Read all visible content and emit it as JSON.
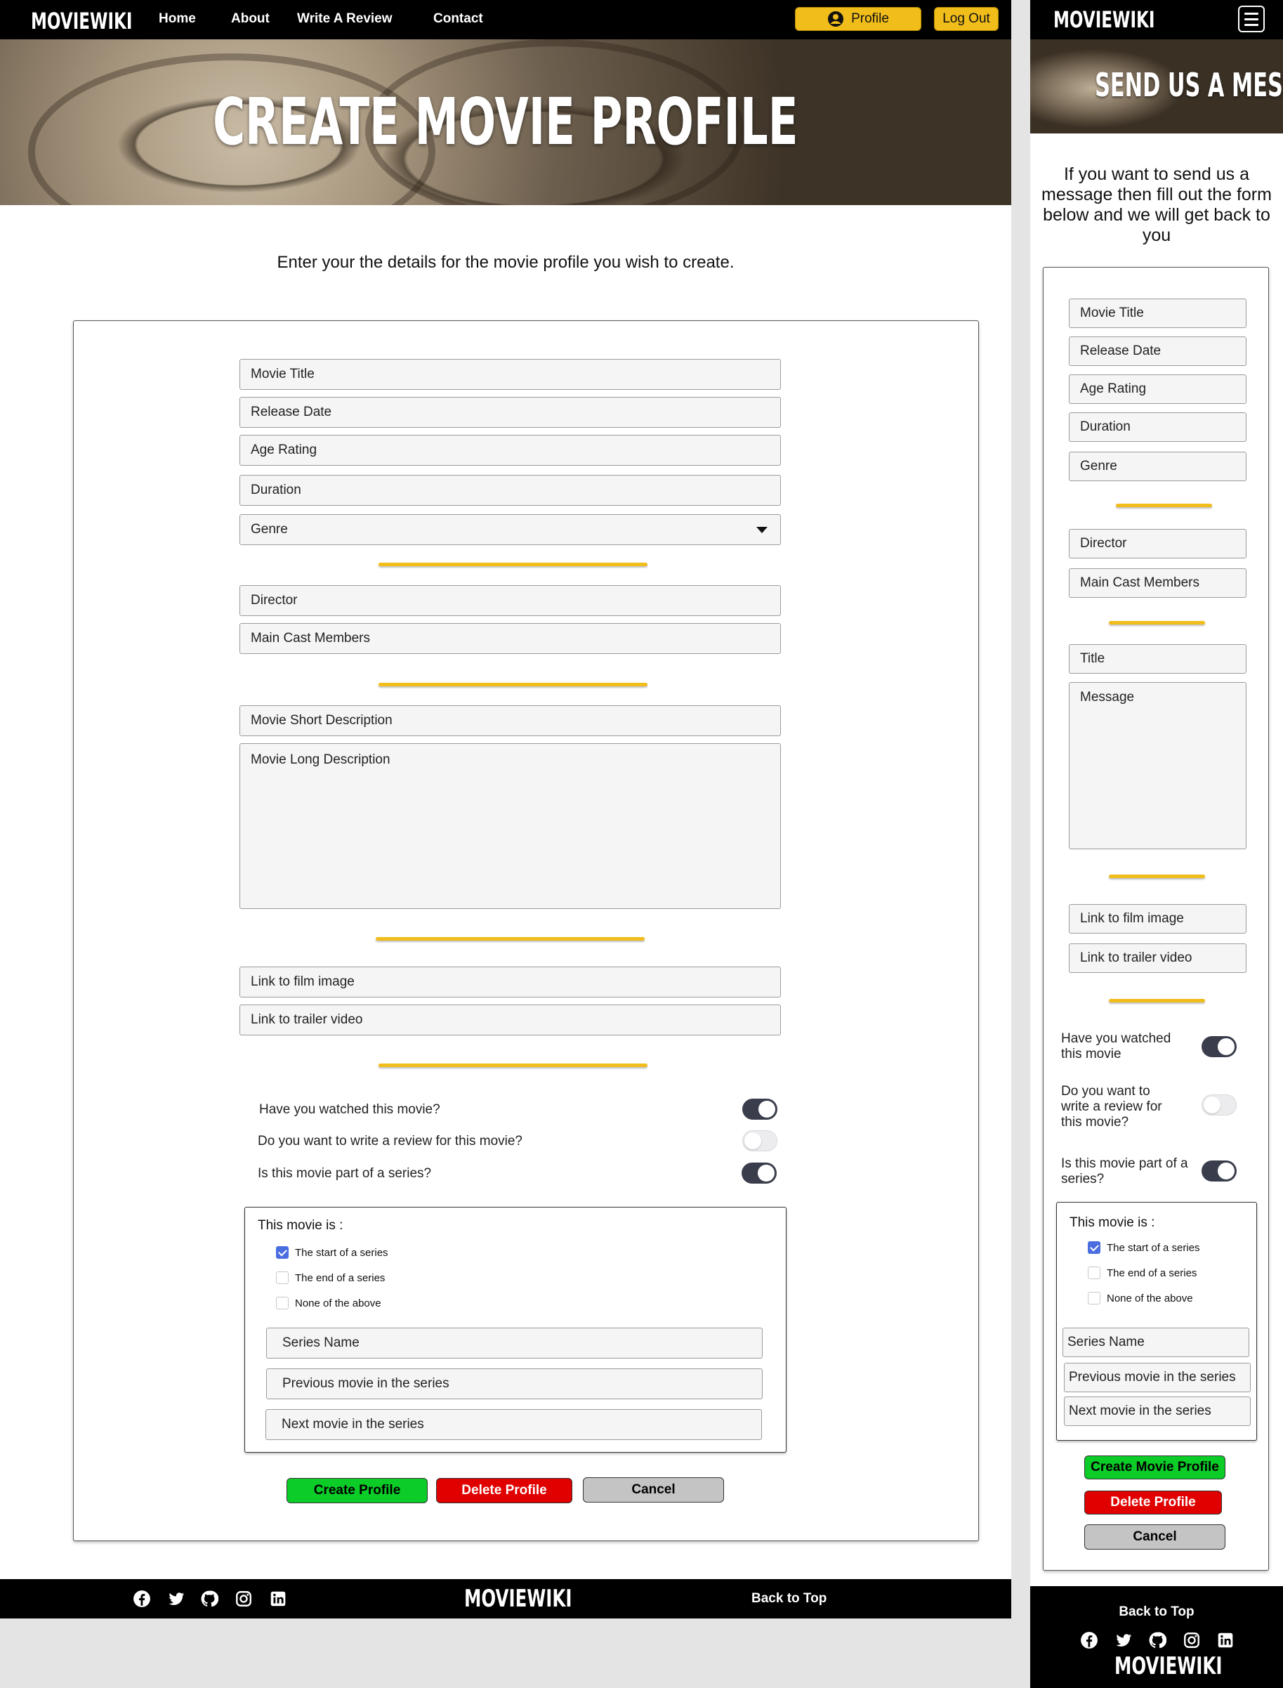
{
  "brand": "MOVIEWIKI",
  "colors": {
    "accent": "#f1bd1b",
    "create": "#0ccc28",
    "delete": "#e00000",
    "cancel": "#c4c4c4",
    "toggle_on": "#3a3d4b",
    "checkbox": "#4a6ee0"
  },
  "nav": {
    "links": [
      "Home",
      "About",
      "Write A Review",
      "Contact"
    ],
    "profile_label": "Profile",
    "profile_icon": "user-circle-icon",
    "logout_label": "Log Out"
  },
  "hero": {
    "title": "CREATE MOVIE PROFILE"
  },
  "intro": "Enter your the details for the movie profile you wish to create.",
  "form": {
    "movie_title": "Movie Title",
    "release_date": "Release Date",
    "age_rating": "Age Rating",
    "duration": "Duration",
    "genre": "Genre",
    "director": "Director",
    "main_cast": "Main Cast Members",
    "short_description": "Movie Short Description",
    "long_description": "Movie Long Description",
    "film_image": "Link to film image",
    "trailer_video": "Link to trailer video",
    "toggles": [
      {
        "label": "Have you watched this movie?",
        "on": true
      },
      {
        "label": "Do you want to write a review for this movie?",
        "on": false
      },
      {
        "label": "Is this movie part of a series?",
        "on": true
      }
    ],
    "series": {
      "heading": "This movie is :",
      "options": [
        {
          "label": "The start of a series",
          "checked": true
        },
        {
          "label": "The end of a series",
          "checked": false
        },
        {
          "label": "None of the above",
          "checked": false
        }
      ],
      "series_name": "Series Name",
      "previous_movie": "Previous movie in the series",
      "next_movie": "Next movie in the series"
    },
    "buttons": {
      "create": "Create Profile",
      "delete": "Delete Profile",
      "cancel": "Cancel"
    }
  },
  "footer": {
    "social_icons": [
      "facebook-icon",
      "twitter-icon",
      "github-icon",
      "instagram-icon",
      "linkedin-icon"
    ],
    "logo": "MOVIEWIKI",
    "back_to_top": "Back to Top"
  },
  "mobile": {
    "logo": "MOVIEWIKI",
    "menu_icon": "hamburger-menu-icon",
    "hero_title": "SEND US A MESSAGE",
    "intro": "If you want to send us a message then fill out the form below and we will get back to you",
    "form": {
      "movie_title": "Movie Title",
      "release_date": "Release Date",
      "age_rating": "Age Rating",
      "duration": "Duration",
      "genre": "Genre",
      "director": "Director",
      "main_cast": "Main Cast Members",
      "title": "Title",
      "message": "Message",
      "film_image": "Link to film image",
      "trailer_video": "Link to trailer video",
      "toggles": [
        {
          "label": "Have you watched this movie",
          "on": true
        },
        {
          "label": "Do you want to write a review for this movie?",
          "on": false
        },
        {
          "label": "Is this movie part of a series?",
          "on": true
        }
      ],
      "series": {
        "heading": "This movie is :",
        "options": [
          {
            "label": "The start of a series",
            "checked": true
          },
          {
            "label": "The end of a series",
            "checked": false
          },
          {
            "label": "None of the above",
            "checked": false
          }
        ],
        "series_name": "Series Name",
        "previous_movie": "Previous movie in the series",
        "next_movie": "Next movie in the series"
      },
      "buttons": {
        "create": "Create Movie Profile",
        "delete": "Delete Profile",
        "cancel": "Cancel"
      }
    },
    "footer": {
      "back_to_top": "Back to Top",
      "logo": "MOVIEWIKI"
    }
  }
}
